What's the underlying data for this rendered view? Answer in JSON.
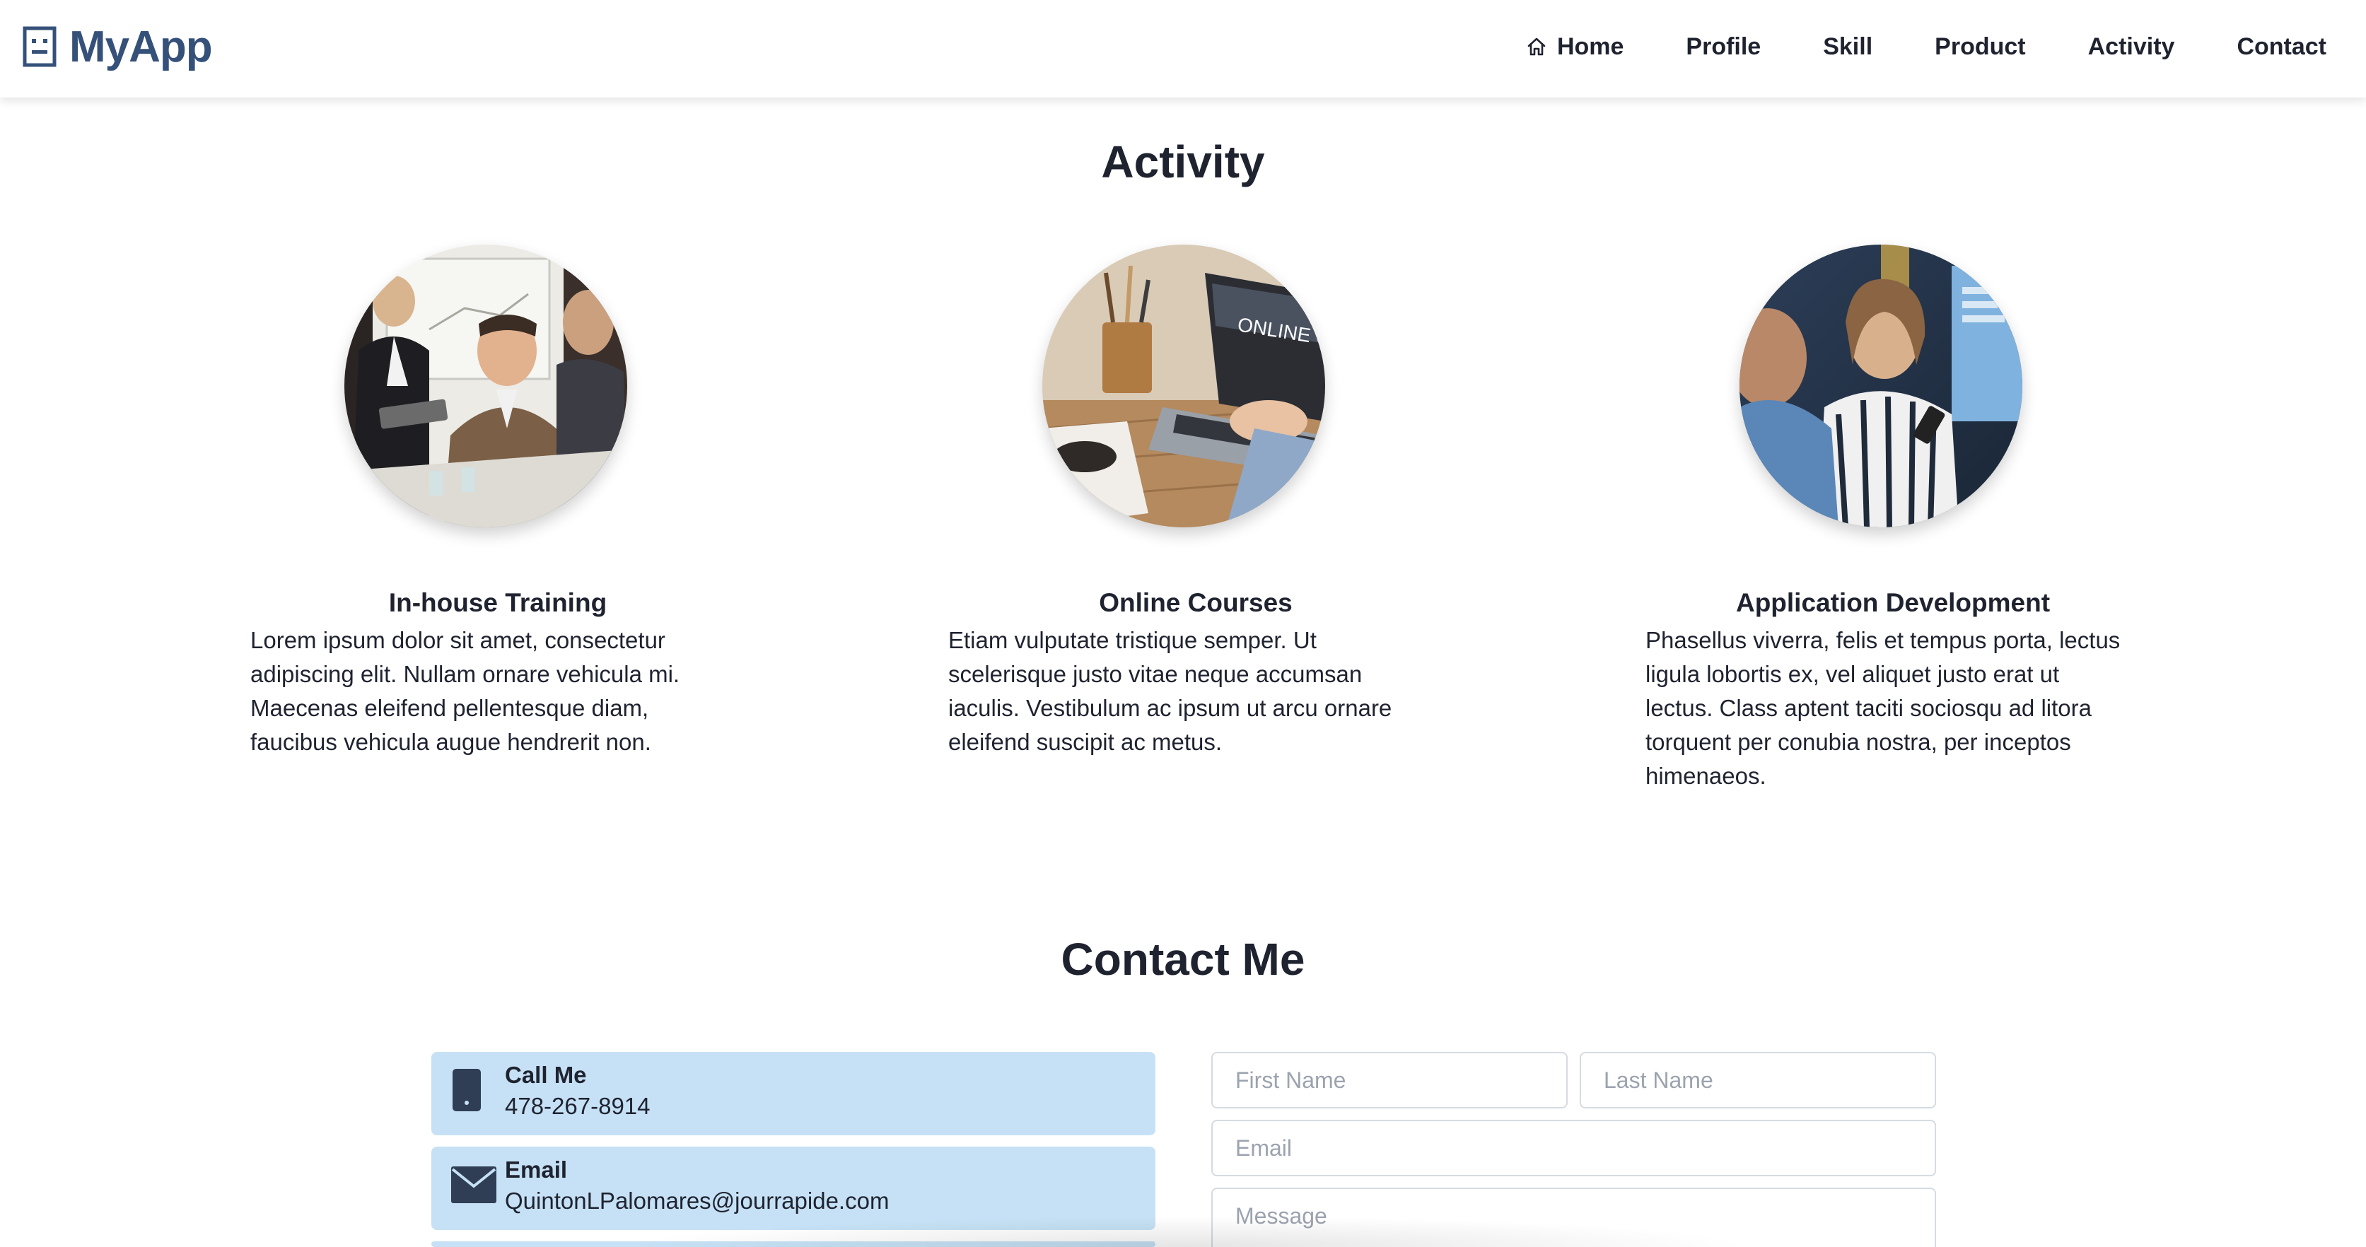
{
  "app": {
    "name": "MyApp",
    "logo_icon": "portrait-frame-icon",
    "brand_color": "#35517a"
  },
  "nav": {
    "items": [
      {
        "label": "Home",
        "icon": "home-icon"
      },
      {
        "label": "Profile"
      },
      {
        "label": "Skill"
      },
      {
        "label": "Product"
      },
      {
        "label": "Activity"
      },
      {
        "label": "Contact"
      }
    ]
  },
  "activity": {
    "title": "Activity",
    "cards": [
      {
        "title": "In-house Training",
        "image": "business-meeting-photo",
        "text": "Lorem ipsum dolor sit amet, consectetur adipiscing elit. Nullam ornare vehicula mi. Maecenas eleifend pellentesque diam, faucibus vehicula augue hendrerit non."
      },
      {
        "title": "Online Courses",
        "image": "laptop-online-course-photo",
        "image_caption": "ONLINE C",
        "text": "Etiam vulputate tristique semper. Ut scelerisque justo vitae neque accumsan iaculis. Vestibulum ac ipsum ut arcu ornare eleifend suscipit ac metus."
      },
      {
        "title": "Application Development",
        "image": "developer-with-phone-photo",
        "text": "Phasellus viverra, felis et tempus porta, lectus ligula lobortis ex, vel aliquet justo erat ut lectus. Class aptent taciti sociosqu ad litora torquent per conubia nostra, per inceptos himenaeos."
      }
    ]
  },
  "contact": {
    "title": "Contact Me",
    "info_color": "#c6e1f5",
    "items": [
      {
        "label": "Call Me",
        "value": "478-267-8914",
        "icon": "phone-icon"
      },
      {
        "label": "Email",
        "value": "QuintonLPalomares@jourrapide.com",
        "icon": "envelope-icon"
      }
    ],
    "form": {
      "first_name_placeholder": "First Name",
      "last_name_placeholder": "Last Name",
      "email_placeholder": "Email",
      "message_placeholder": "Message"
    }
  }
}
